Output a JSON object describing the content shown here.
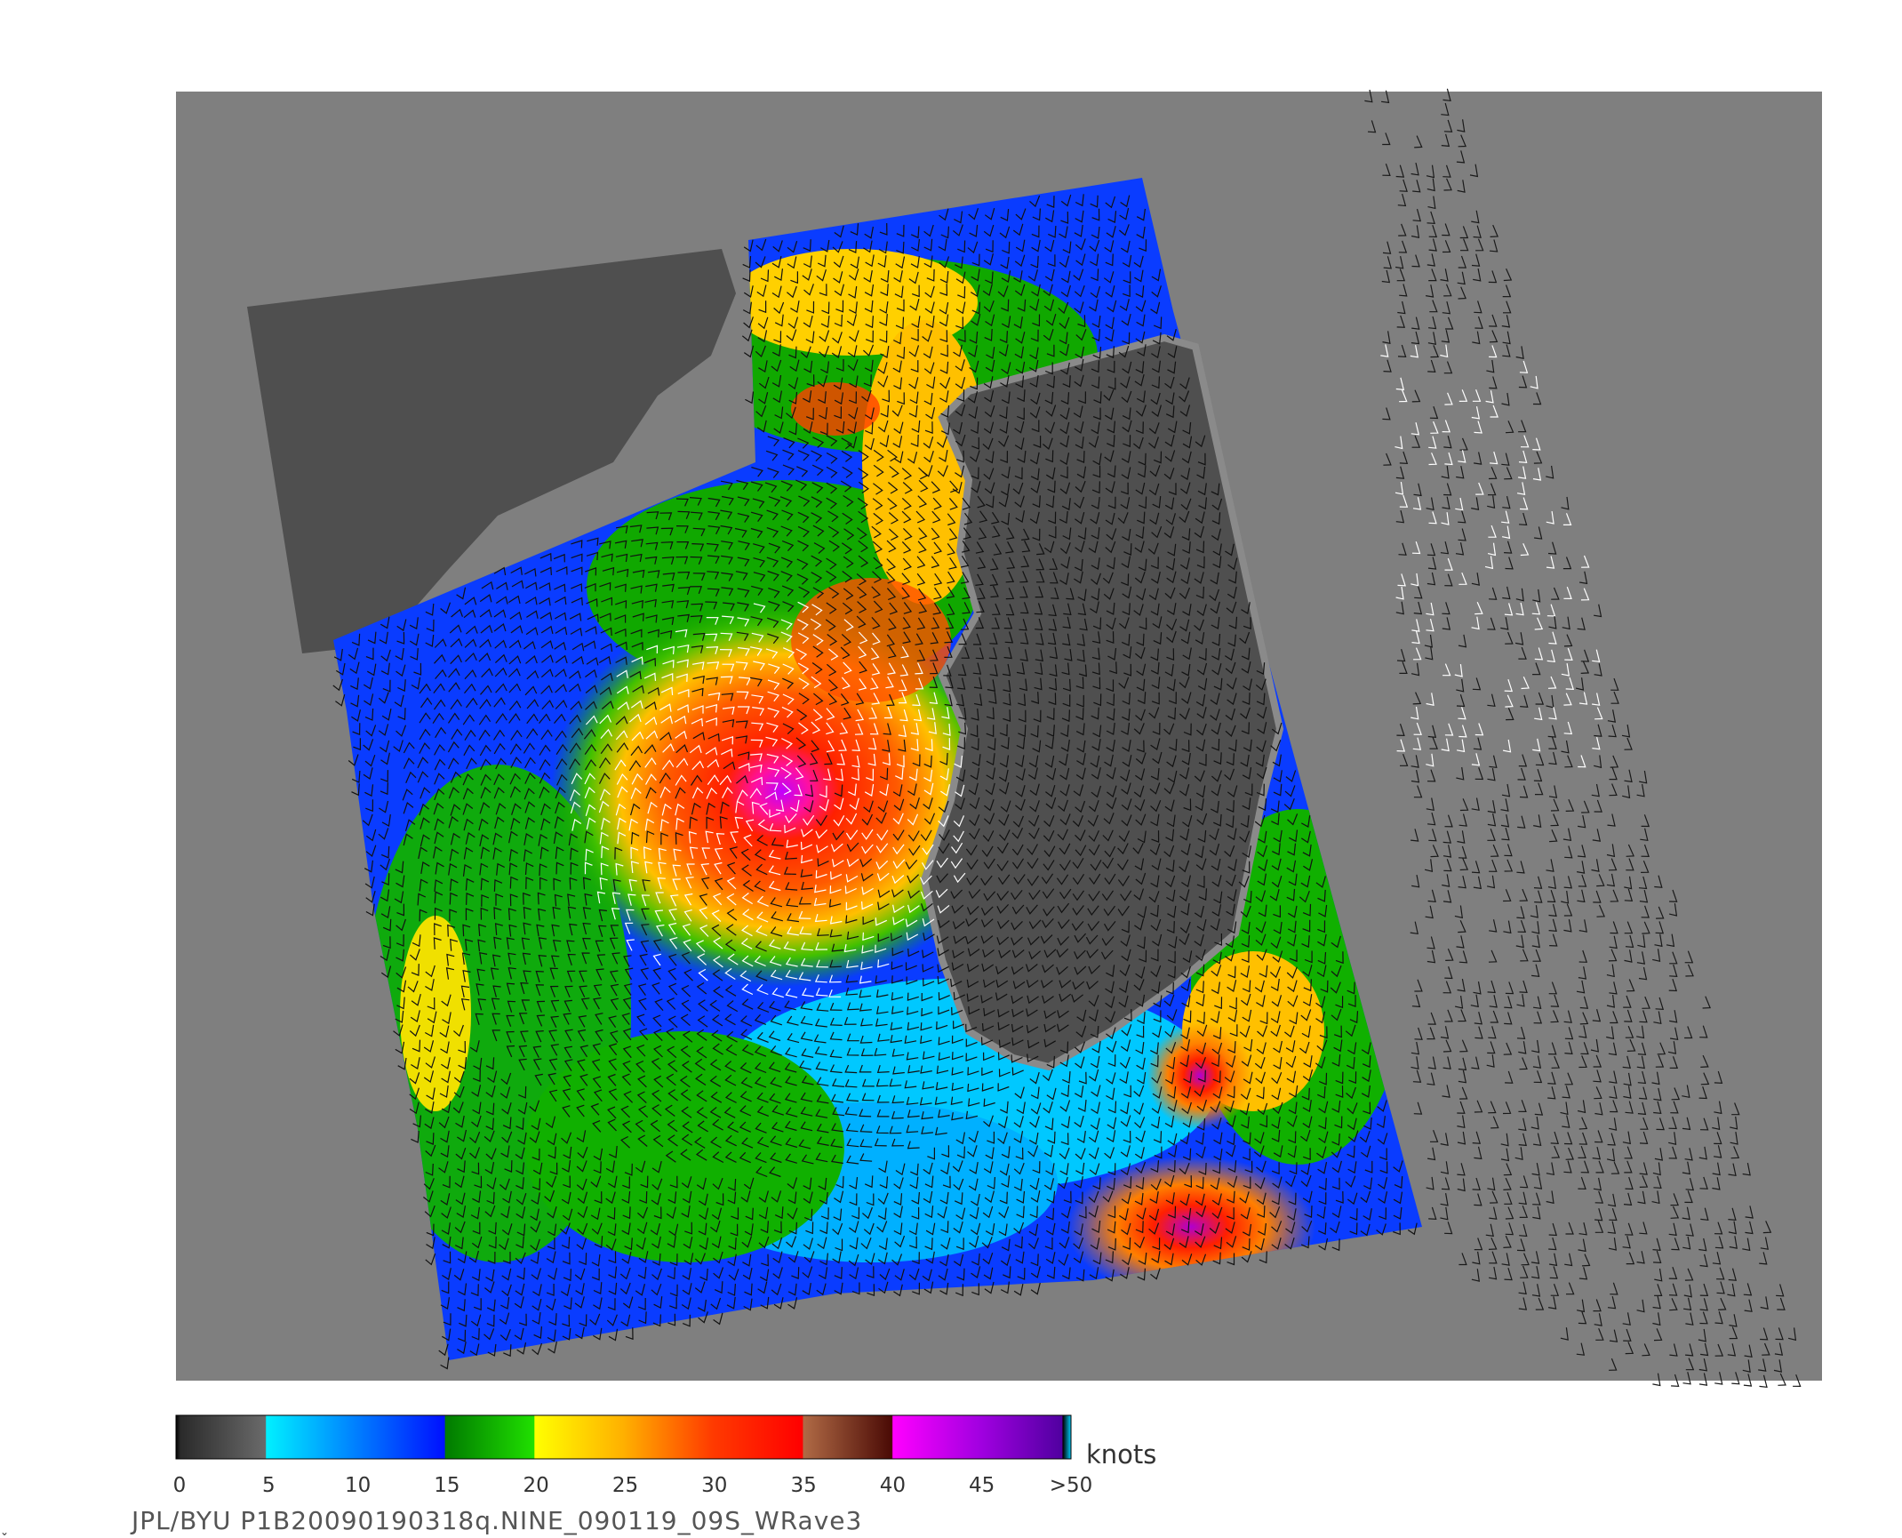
{
  "caption": "JPL/BYU  P1B20090190318q.NINE_090119_09S_WRave3",
  "colorbar": {
    "units": "knots",
    "labels": [
      "0",
      "5",
      "10",
      "15",
      "20",
      "25",
      "30",
      "35",
      "40",
      "45",
      ">50"
    ],
    "colors": [
      "#000000",
      "#303030",
      "#6a6a6a",
      "#00e8ff",
      "#0010ff",
      "#00a000",
      "#10e000",
      "#ffff00",
      "#ffa500",
      "#ff4000",
      "#ff0000",
      "#a05a35",
      "#4a1005",
      "#ff00ff",
      "#9000e0",
      "#5a00a0"
    ]
  },
  "map": {
    "background": "#7f7f7f",
    "land": "#4f4f4f",
    "icon": "wind-barb-icon"
  },
  "corner_mark": "⌄"
}
